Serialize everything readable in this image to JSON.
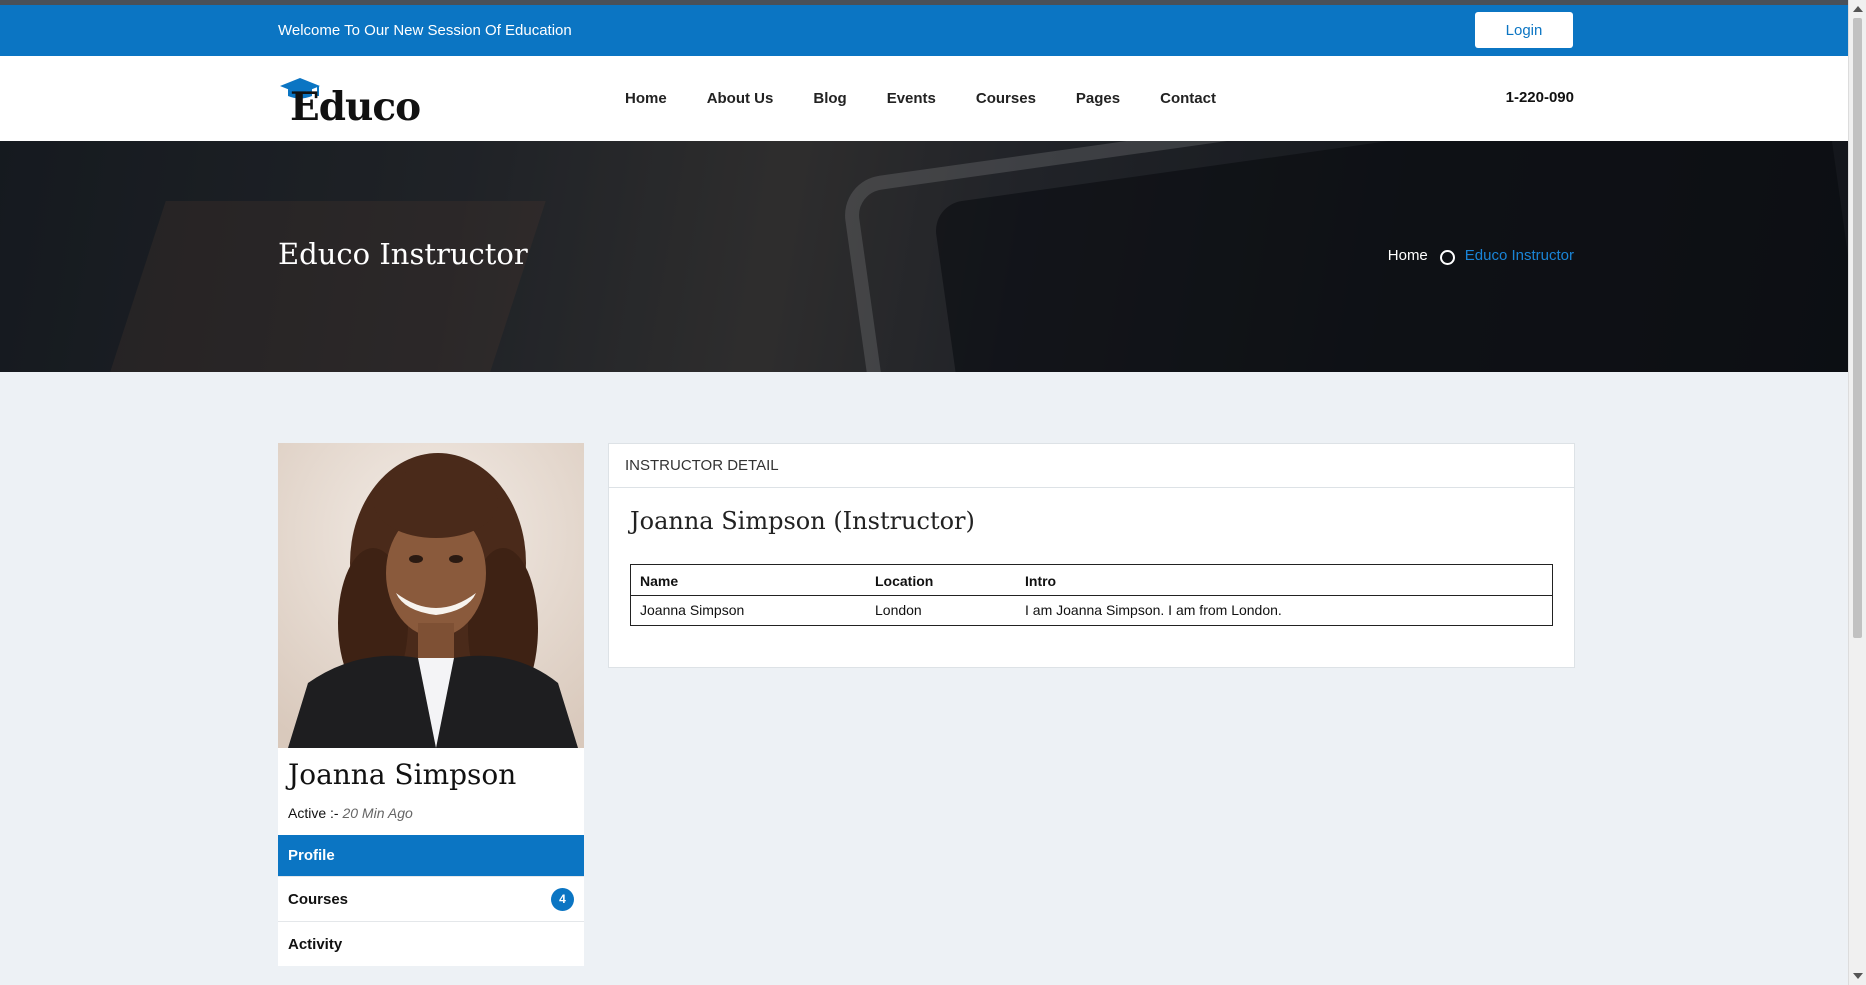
{
  "topbar": {
    "welcome": "Welcome To Our New Session Of Education",
    "login_label": "Login"
  },
  "header": {
    "logo_text": "Educo",
    "nav": [
      "Home",
      "About Us",
      "Blog",
      "Events",
      "Courses",
      "Pages",
      "Contact"
    ],
    "phone": "1-220-090"
  },
  "banner": {
    "title": "Educo Instructor",
    "breadcrumb": {
      "home": "Home",
      "current": "Educo Instructor"
    }
  },
  "profile": {
    "name": "Joanna Simpson",
    "active_label": "Active :-",
    "active_time": "20 Min Ago",
    "menu": [
      {
        "label": "Profile"
      },
      {
        "label": "Courses",
        "badge": "4"
      },
      {
        "label": "Activity"
      }
    ]
  },
  "detail": {
    "header": "INSTRUCTOR DETAIL",
    "title": "Joanna Simpson (Instructor)",
    "columns": [
      "Name",
      "Location",
      "Intro"
    ],
    "rows": [
      [
        "Joanna Simpson",
        "London",
        "I am Joanna Simpson. I am from London."
      ]
    ]
  },
  "colors": {
    "brand_blue": "#0b75c3",
    "link_blue": "#1a84d6",
    "page_bg": "#edf1f5"
  },
  "icons": [
    "graduation-cap-icon",
    "breadcrumb-circle-icon"
  ]
}
